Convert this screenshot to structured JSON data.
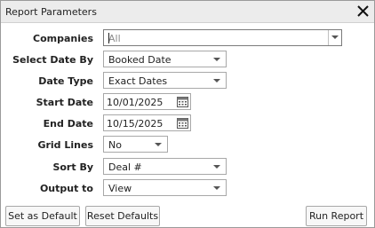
{
  "dialog": {
    "title": "Report Parameters",
    "close_icon": "close-icon"
  },
  "fields": {
    "companies": {
      "label": "Companies",
      "value": "All"
    },
    "select_date_by": {
      "label": "Select Date By",
      "value": "Booked Date"
    },
    "date_type": {
      "label": "Date Type",
      "value": "Exact Dates"
    },
    "start_date": {
      "label": "Start Date",
      "value": "10/01/2025"
    },
    "end_date": {
      "label": "End Date",
      "value": "10/15/2025"
    },
    "grid_lines": {
      "label": "Grid Lines",
      "value": "No"
    },
    "sort_by": {
      "label": "Sort By",
      "value": "Deal #"
    },
    "output_to": {
      "label": "Output to",
      "value": "View"
    }
  },
  "buttons": {
    "set_default": "Set as Default",
    "reset_defaults": "Reset Defaults",
    "run_report": "Run Report"
  },
  "colors": {
    "titlebar_bg": "#ececec",
    "border": "#a8a8a8"
  }
}
